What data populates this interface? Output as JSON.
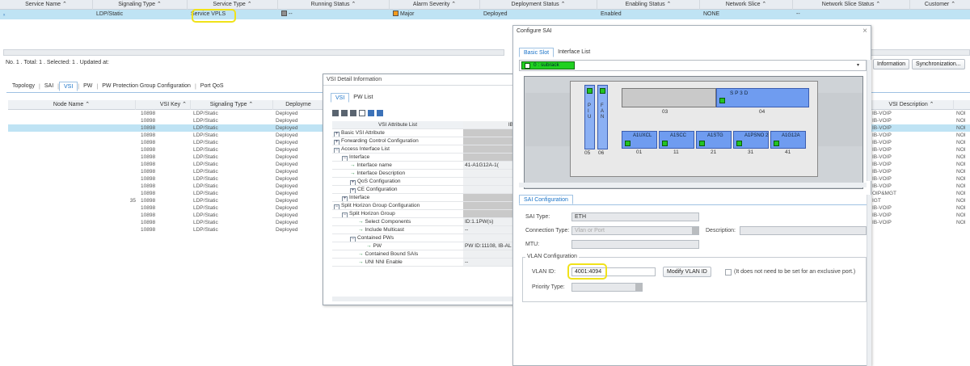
{
  "top_table": {
    "headers": [
      "Service Name",
      "Signaling Type",
      "Service Type",
      "Running Status",
      "Alarm Severity",
      "Deployment Status",
      "Enabling Status",
      "Network Slice",
      "Network Slice Status",
      "Customer"
    ],
    "row": {
      "signaling": "LDP/Static",
      "service_type": "Service VPLS",
      "running": "--",
      "alarm": "Major",
      "deployment": "Deployed",
      "enabling": "Enabled",
      "slice": "NONE",
      "slice_status": "--"
    }
  },
  "status_bar": "No. 1 . Total: 1 . Selected: 1 . Updated at:",
  "right_buttons": {
    "information": "Information",
    "sync": "Synchronization..."
  },
  "bottom_tabs": [
    "Topology",
    "SAI",
    "VSI",
    "PW",
    "PW Protection Group Configuration",
    "Port QoS"
  ],
  "vsi_grid": {
    "headers": {
      "node": "Node Name",
      "key": "VSI Key",
      "sig": "Signaling Type",
      "dep": "Deployme"
    },
    "rows": [
      {
        "node": "",
        "key": "10898",
        "sig": "LDP/Static",
        "dep": "Deployed"
      },
      {
        "node": "",
        "key": "10898",
        "sig": "LDP/Static",
        "dep": "Deployed"
      },
      {
        "node": "",
        "key": "10898",
        "sig": "LDP/Static",
        "dep": "Deployed"
      },
      {
        "node": "",
        "key": "10898",
        "sig": "LDP/Static",
        "dep": "Deployed"
      },
      {
        "node": "",
        "key": "10898",
        "sig": "LDP/Static",
        "dep": "Deployed"
      },
      {
        "node": "",
        "key": "10898",
        "sig": "LDP/Static",
        "dep": "Deployed"
      },
      {
        "node": "",
        "key": "10898",
        "sig": "LDP/Static",
        "dep": "Deployed"
      },
      {
        "node": "",
        "key": "10898",
        "sig": "LDP/Static",
        "dep": "Deployed"
      },
      {
        "node": "",
        "key": "10898",
        "sig": "LDP/Static",
        "dep": "Deployed"
      },
      {
        "node": "",
        "key": "10898",
        "sig": "LDP/Static",
        "dep": "Deployed"
      },
      {
        "node": "",
        "key": "10898",
        "sig": "LDP/Static",
        "dep": "Deployed"
      },
      {
        "node": "",
        "key": "10898",
        "sig": "LDP/Static",
        "dep": "Deployed"
      },
      {
        "node": "35",
        "key": "10898",
        "sig": "LDP/Static",
        "dep": "Deployed"
      },
      {
        "node": "",
        "key": "10898",
        "sig": "LDP/Static",
        "dep": "Deployed"
      },
      {
        "node": "",
        "key": "10898",
        "sig": "LDP/Static",
        "dep": "Deployed"
      },
      {
        "node": "",
        "key": "10898",
        "sig": "LDP/Static",
        "dep": "Deployed"
      },
      {
        "node": "",
        "key": "10898",
        "sig": "LDP/Static",
        "dep": "Deployed"
      }
    ]
  },
  "right_grid": {
    "header": "VSI Description",
    "rows": [
      [
        "IB-VOIP",
        "NOI"
      ],
      [
        "IB-VOIP",
        "NOI"
      ],
      [
        "IB-VOIP",
        "NOI"
      ],
      [
        "IB-VOIP",
        "NOI"
      ],
      [
        "IB-VOIP",
        "NOI"
      ],
      [
        "IB-VOIP",
        "NOI"
      ],
      [
        "IB-VOIP",
        "NOI"
      ],
      [
        "IB-VOIP",
        "NOI"
      ],
      [
        "IB-VOIP",
        "NOI"
      ],
      [
        "IB-VOIP",
        "NOI"
      ],
      [
        "IB-VOIP",
        "NOI"
      ],
      [
        "OIP&MGT",
        "NOI"
      ],
      [
        "IGT",
        "NOI"
      ],
      [
        "IB-VOIP",
        "NOI"
      ],
      [
        "IB-VOIP",
        "NOI"
      ],
      [
        "IB-VOIP",
        "NOI"
      ]
    ]
  },
  "vsi_detail": {
    "title": "VSI Detail Information",
    "tabs": [
      "VSI",
      "PW List"
    ],
    "col1": "VSI Attribute List",
    "col2": "IB",
    "tree": [
      {
        "indent": 0,
        "pm": "+",
        "label": "Basic VSI Attribute",
        "val": ""
      },
      {
        "indent": 0,
        "pm": "+",
        "label": "Forwarding Control Configuration",
        "val": ""
      },
      {
        "indent": 0,
        "pm": "−",
        "label": "Access Interface List",
        "val": ""
      },
      {
        "indent": 1,
        "pm": "−",
        "label": "Interface",
        "val": ""
      },
      {
        "indent": 2,
        "pm": "→",
        "label": "Interface name",
        "val": "41-A1G12A-1("
      },
      {
        "indent": 2,
        "pm": "→",
        "label": "Interface Description",
        "val": ""
      },
      {
        "indent": 2,
        "pm": "+",
        "label": "QoS Configuration",
        "val": ""
      },
      {
        "indent": 2,
        "pm": "+",
        "label": "CE Configuration",
        "val": ""
      },
      {
        "indent": 1,
        "pm": "+",
        "label": "Interface",
        "val": ""
      },
      {
        "indent": 0,
        "pm": "−",
        "label": "Split Horizon Group Configuration",
        "val": ""
      },
      {
        "indent": 1,
        "pm": "−",
        "label": "Split Horizon Group",
        "val": ""
      },
      {
        "indent": 3,
        "pm": "→",
        "label": "Select Components",
        "val": "ID:1.1PW(s)"
      },
      {
        "indent": 3,
        "pm": "→",
        "label": "Include Multicast",
        "val": "--"
      },
      {
        "indent": 2,
        "pm": "−",
        "label": "Contained PWs",
        "val": ""
      },
      {
        "indent": 4,
        "pm": "→",
        "label": "PW",
        "val": "PW ID:11108, IB-AL"
      },
      {
        "indent": 3,
        "pm": "→",
        "label": "Contained Bound SAIs",
        "val": ""
      },
      {
        "indent": 3,
        "pm": "→",
        "label": "UNI NNI Enable",
        "val": "--"
      }
    ]
  },
  "sai_dialog": {
    "title": "Configure SAI",
    "tabs": [
      "Basic Slot",
      "Interface List"
    ],
    "subrack": "0 : subrack",
    "slots": {
      "s03": "03",
      "s04": "04",
      "sp3d": "S P 3 D",
      "piu": "P I U",
      "fan": "F A N",
      "b05": "05",
      "b06": "06",
      "a1": "A1UXCL",
      "a2": "A1SCC",
      "a3": "A1STG",
      "a4": "A1PSNO 2",
      "a5": "A1G12A",
      "n01": "01",
      "n11": "11",
      "n21": "21",
      "n31": "31",
      "n41": "41"
    },
    "section": "SAI Configuration",
    "sai_type_label": "SAI Type:",
    "sai_type": "ETH",
    "conn_label": "Connection Type:",
    "conn_value": "Vlan or Port",
    "desc_label": "Description:",
    "mtu_label": "MTU:",
    "vlan_group": "VLAN Configuration",
    "vlan_label": "VLAN ID:",
    "vlan_value": "4001:4094",
    "modify_btn": "Modify VLAN ID",
    "note": "(It does not need to be set for an exclusive port.)",
    "priority_label": "Priority Type:"
  },
  "colors": {
    "selected": "#bfe3f4",
    "major": "#f39a1c",
    "slot": "#6f9cf0",
    "led": "#23c323",
    "highlight": "#f0e21a"
  }
}
